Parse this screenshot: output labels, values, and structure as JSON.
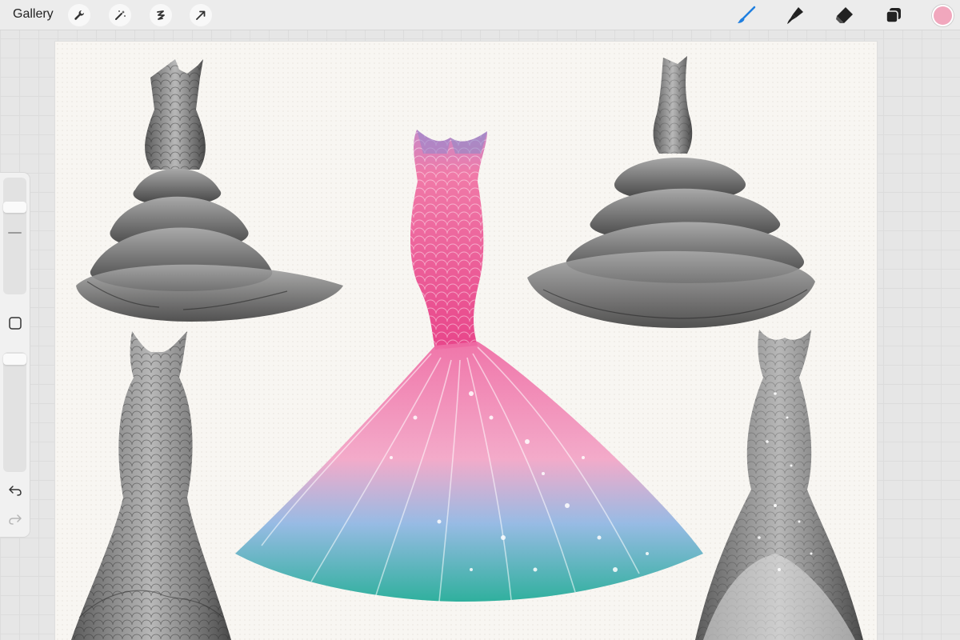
{
  "app": {
    "gallery_label": "Gallery"
  },
  "toolbar": {
    "left_tools": [
      "wrench-icon",
      "magic-wand-icon",
      "selection-icon",
      "transform-arrow-icon"
    ],
    "right_tools": [
      "brush-icon",
      "smudge-icon",
      "eraser-icon",
      "layers-icon"
    ],
    "active_tool": "brush-icon",
    "current_color": "#f1a7bd",
    "accent_color": "#1f7fe0"
  },
  "sidebar": {
    "controls": [
      "brush-size-slider",
      "modify-button",
      "opacity-slider",
      "undo-icon",
      "redo-icon"
    ]
  },
  "canvas": {
    "artwork": [
      "ruffled-grey-gown",
      "pink-mermaid-gown",
      "tiered-grey-gown",
      "scaled-grey-gown",
      "sparkle-grey-gown"
    ]
  }
}
